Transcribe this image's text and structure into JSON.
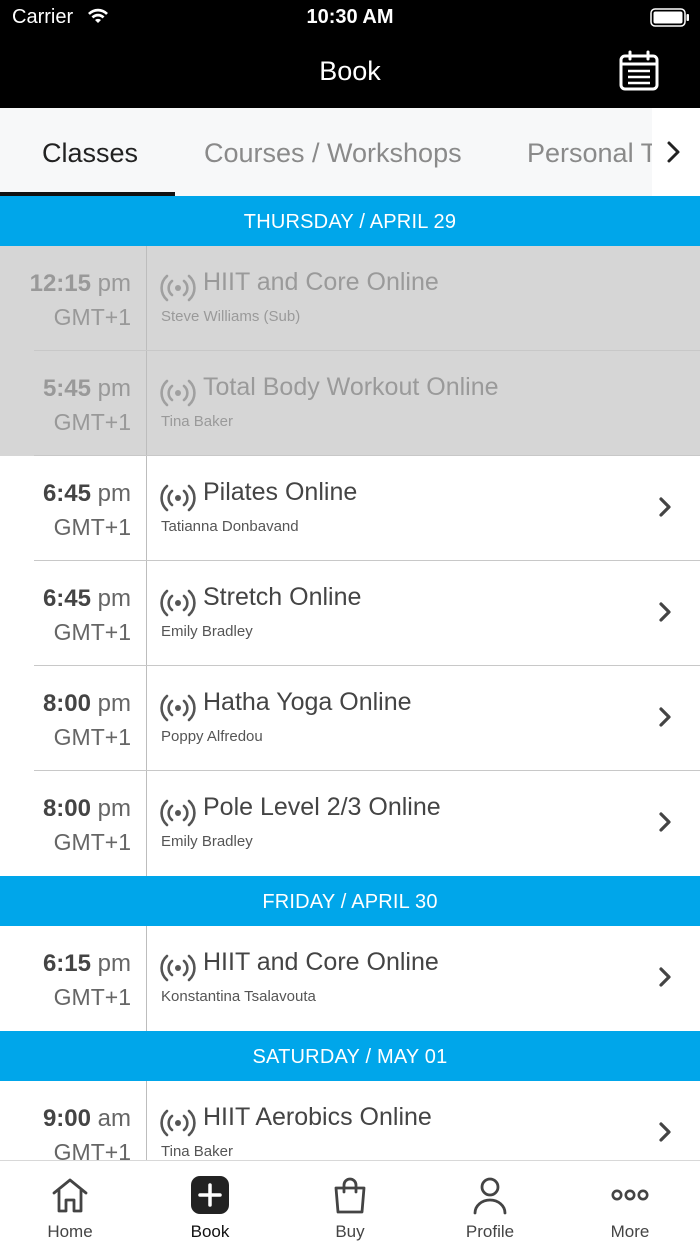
{
  "status_bar": {
    "carrier": "Carrier",
    "time": "10:30 AM"
  },
  "nav": {
    "title": "Book",
    "calendar_icon": "calendar-icon"
  },
  "tabs": [
    {
      "label": "Classes",
      "active": true
    },
    {
      "label": "Courses / Workshops",
      "active": false
    },
    {
      "label": "Personal Training",
      "active": false
    }
  ],
  "schedule": {
    "days": [
      {
        "header": "THURSDAY / APRIL 29",
        "classes": [
          {
            "time": "12:15",
            "ampm": "pm",
            "tz": "GMT+1",
            "name": "HIIT and Core Online",
            "instructor": "Steve Williams (Sub)",
            "past": true
          },
          {
            "time": "5:45",
            "ampm": "pm",
            "tz": "GMT+1",
            "name": "Total Body Workout Online",
            "instructor": "Tina Baker",
            "past": true
          },
          {
            "time": "6:45",
            "ampm": "pm",
            "tz": "GMT+1",
            "name": "Pilates Online",
            "instructor": "Tatianna Donbavand",
            "past": false
          },
          {
            "time": "6:45",
            "ampm": "pm",
            "tz": "GMT+1",
            "name": "Stretch Online",
            "instructor": "Emily Bradley",
            "past": false
          },
          {
            "time": "8:00",
            "ampm": "pm",
            "tz": "GMT+1",
            "name": "Hatha Yoga Online",
            "instructor": "Poppy Alfredou",
            "past": false
          },
          {
            "time": "8:00",
            "ampm": "pm",
            "tz": "GMT+1",
            "name": "Pole Level 2/3 Online",
            "instructor": "Emily Bradley",
            "past": false
          }
        ]
      },
      {
        "header": "FRIDAY / APRIL 30",
        "classes": [
          {
            "time": "6:15",
            "ampm": "pm",
            "tz": "GMT+1",
            "name": "HIIT and Core Online",
            "instructor": "Konstantina Tsalavouta",
            "past": false
          }
        ]
      },
      {
        "header": "SATURDAY / MAY 01",
        "classes": [
          {
            "time": "9:00",
            "ampm": "am",
            "tz": "GMT+1",
            "name": "HIIT Aerobics Online",
            "instructor": "Tina Baker",
            "past": false
          }
        ]
      }
    ]
  },
  "tab_bar": [
    {
      "label": "Home",
      "icon": "home-icon",
      "active": false
    },
    {
      "label": "Book",
      "icon": "plus-icon",
      "active": true
    },
    {
      "label": "Buy",
      "icon": "shopping-bag-icon",
      "active": false
    },
    {
      "label": "Profile",
      "icon": "person-icon",
      "active": false
    },
    {
      "label": "More",
      "icon": "more-dots-icon",
      "active": false
    }
  ],
  "colors": {
    "accent": "#00a6ea",
    "nav_bg": "#000000",
    "past_row": "#d6d6d6"
  }
}
